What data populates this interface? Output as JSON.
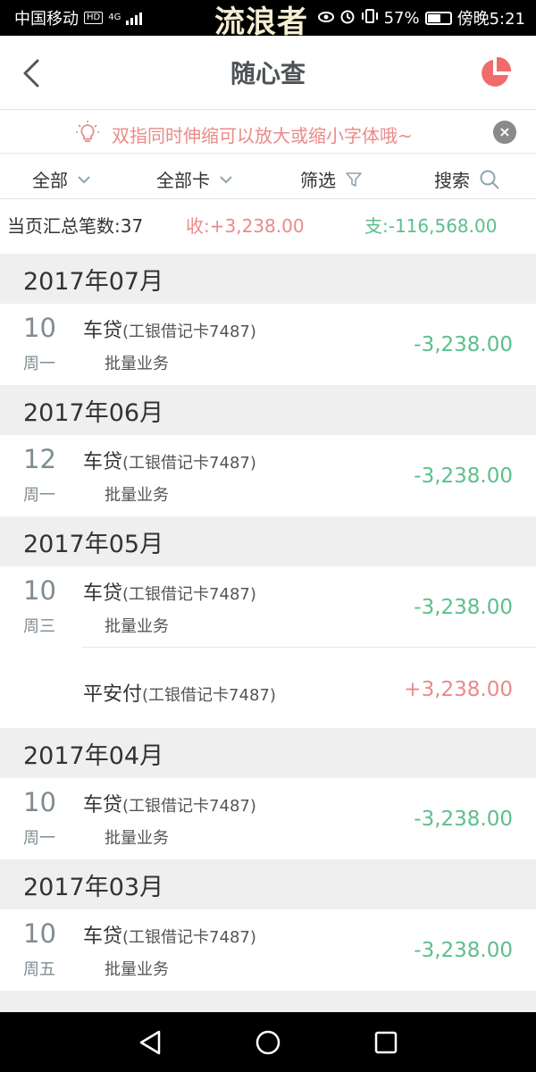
{
  "status_bar": {
    "carrier": "中国移动",
    "hd_badge": "HD",
    "network": "4G",
    "watermark": "流浪者",
    "battery_percent": "57%",
    "battery_level": 0.57,
    "time": "傍晚5:21"
  },
  "header": {
    "title": "随心查",
    "back_icon": "chevron-left-icon",
    "chart_icon": "pie-chart-icon",
    "accent_color": "#f06b6b"
  },
  "tip": {
    "text": "双指同时伸缩可以放大或缩小字体哦~",
    "close_label": "×",
    "icon": "lightbulb-icon"
  },
  "filters": {
    "all": "全部",
    "all_cards": "全部卡",
    "filter": "筛选",
    "search": "搜索"
  },
  "summary": {
    "count_text": "当页汇总笔数:37",
    "income_text": "收:+3,238.00",
    "expense_text": "支:-116,568.00"
  },
  "colors": {
    "income": "#e98b8a",
    "expense": "#5cbf8c"
  },
  "months": [
    {
      "month": "2017年07月",
      "entries": [
        {
          "day": "10",
          "weekday": "周一",
          "name": "车贷",
          "card": "(工银借记卡7487)",
          "type": "批量业务",
          "amount": "-3,238.00"
        }
      ]
    },
    {
      "month": "2017年06月",
      "entries": [
        {
          "day": "12",
          "weekday": "周一",
          "name": "车贷",
          "card": "(工银借记卡7487)",
          "type": "批量业务",
          "amount": "-3,238.00"
        }
      ]
    },
    {
      "month": "2017年05月",
      "entries": [
        {
          "day": "10",
          "weekday": "周三",
          "name": "车贷",
          "card": "(工银借记卡7487)",
          "type": "批量业务",
          "amount": "-3,238.00"
        },
        {
          "name": "平安付",
          "card": "(工银借记卡7487)",
          "amount": "+3,238.00"
        }
      ]
    },
    {
      "month": "2017年04月",
      "entries": [
        {
          "day": "10",
          "weekday": "周一",
          "name": "车贷",
          "card": "(工银借记卡7487)",
          "type": "批量业务",
          "amount": "-3,238.00"
        }
      ]
    },
    {
      "month": "2017年03月",
      "entries": [
        {
          "day": "10",
          "weekday": "周五",
          "name": "车贷",
          "card": "(工银借记卡7487)",
          "type": "批量业务",
          "amount": "-3,238.00"
        }
      ]
    }
  ],
  "nav": {
    "back": "back-triangle-icon",
    "home": "home-circle-icon",
    "recents": "recents-square-icon"
  }
}
